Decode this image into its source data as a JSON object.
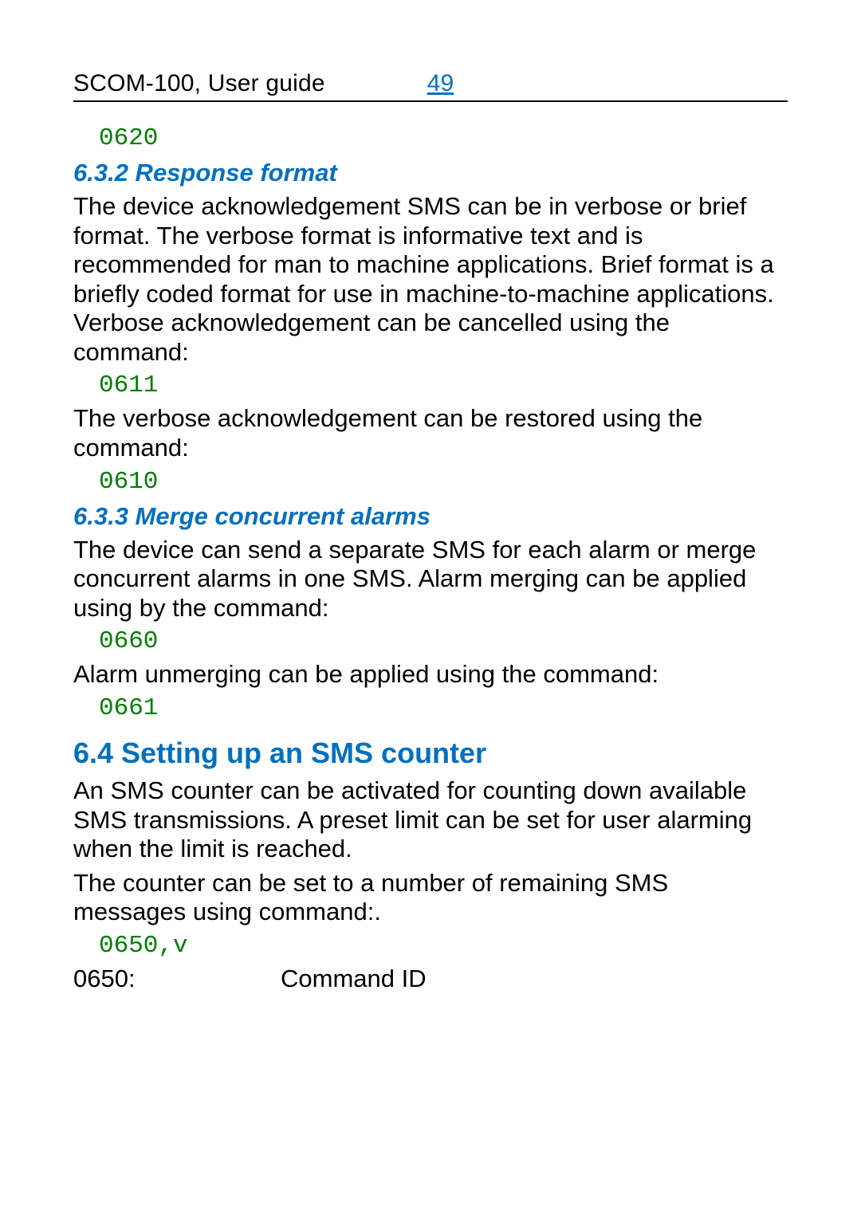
{
  "header": {
    "title": "SCOM-100, User guide",
    "page": "49"
  },
  "code1": "0620",
  "sec_632": {
    "heading": "6.3.2 Response format",
    "p1": "The device acknowledgement SMS can be in verbose or brief format. The verbose format is informative text and is recommended for man to machine applications. Brief format is a briefly coded format for use in machine-to-machine applications. Verbose acknowledgement can be cancelled using the command:",
    "code1": "0611",
    "p2": "The verbose acknowledgement can be restored using the command:",
    "code2": "0610"
  },
  "sec_633": {
    "heading": "6.3.3 Merge concurrent alarms",
    "p1": "The device can send a separate SMS for each alarm or merge concurrent alarms in one SMS. Alarm merging can be applied using by the command:",
    "code1": "0660",
    "p2": "Alarm unmerging can be applied using the command:",
    "code2": "0661"
  },
  "sec_64": {
    "heading": "6.4 Setting up an SMS counter",
    "p1": "An SMS counter can be activated for counting down available SMS transmissions. A preset limit can be set for user alarming when the limit is reached.",
    "p2": "The counter can be set to a number of remaining SMS messages using command:.",
    "code1": "0650,v",
    "cmd_label": "0650:",
    "cmd_desc": "Command ID"
  }
}
